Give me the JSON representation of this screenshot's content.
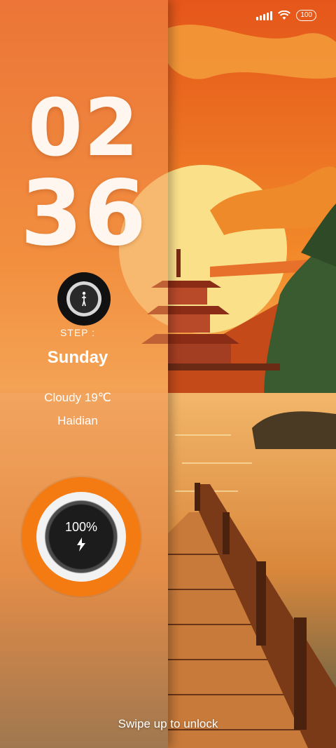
{
  "status_bar": {
    "battery_level": "100"
  },
  "clock": {
    "hours": "02",
    "minutes": "36"
  },
  "steps": {
    "label": "STEP :"
  },
  "date": {
    "day": "Sunday"
  },
  "weather": {
    "condition_temp": "Cloudy  19℃",
    "city": "Haidian"
  },
  "battery_widget": {
    "percent": "100%"
  },
  "lockscreen": {
    "unlock_hint": "Swipe up to unlock"
  },
  "colors": {
    "accent_orange": "#f47a12",
    "sky": "#e8661c",
    "sun": "#fbe08a",
    "water": "#6a4a2a"
  }
}
